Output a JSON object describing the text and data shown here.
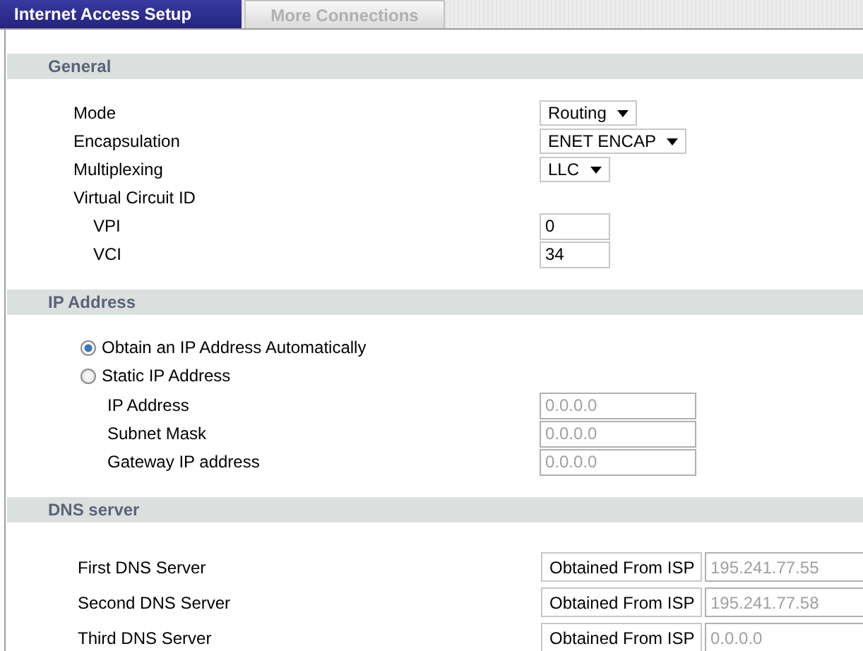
{
  "tabs": [
    {
      "label": "Internet Access Setup",
      "selected": true
    },
    {
      "label": "More Connections",
      "selected": false
    }
  ],
  "sections": [
    {
      "title": "General",
      "rows": [
        {
          "kind": "select",
          "label": "Mode",
          "value": "Routing"
        },
        {
          "kind": "select",
          "label": "Encapsulation",
          "value": "ENET ENCAP"
        },
        {
          "kind": "select",
          "label": "Multiplexing",
          "value": "LLC"
        },
        {
          "kind": "label",
          "label": "Virtual Circuit ID",
          "children": [
            {
              "kind": "text",
              "label": "VPI",
              "value": "0",
              "disabled": false
            },
            {
              "kind": "text",
              "label": "VCI",
              "value": "34",
              "disabled": false
            }
          ]
        }
      ]
    },
    {
      "title": "IP Address",
      "rows": [
        {
          "kind": "radio",
          "label": "Obtain an IP Address Automatically",
          "selected": true
        },
        {
          "kind": "radio",
          "label": "Static IP Address",
          "selected": false,
          "children": [
            {
              "kind": "text",
              "label": "IP Address",
              "value": "0.0.0.0",
              "disabled": true
            },
            {
              "kind": "text",
              "label": "Subnet Mask",
              "value": "0.0.0.0",
              "disabled": true
            },
            {
              "kind": "text",
              "label": "Gateway IP address",
              "value": "0.0.0.0",
              "disabled": true
            }
          ]
        }
      ]
    },
    {
      "title": "DNS server",
      "rows": [
        {
          "kind": "dns",
          "label": "First DNS Server",
          "value": "Obtained From ISP",
          "address": "195.241.77.55",
          "disabled": true
        },
        {
          "kind": "dns",
          "label": "Second DNS Server",
          "value": "Obtained From ISP",
          "address": "195.241.77.58",
          "disabled": true
        },
        {
          "kind": "dns",
          "label": "Third DNS Server",
          "value": "Obtained From ISP",
          "address": "0.0.0.0",
          "disabled": true
        }
      ]
    }
  ]
}
